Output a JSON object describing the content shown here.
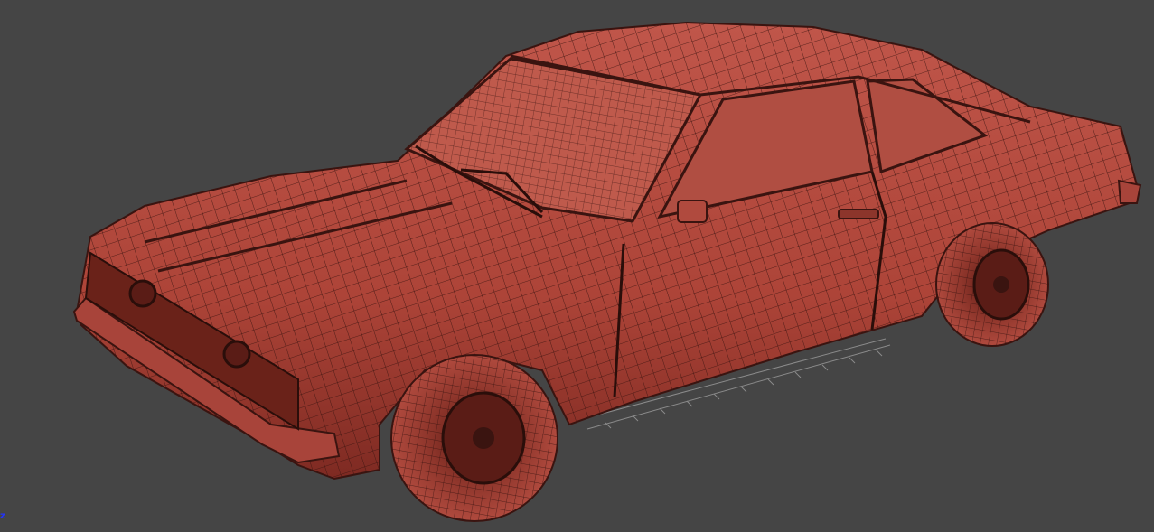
{
  "viewport": {
    "background_color": "#454545",
    "model_color": "#b44a3c",
    "wire_color": "#3a1410",
    "grid_color": "#8a8a8a"
  },
  "axis_gizmo": {
    "z_label": "z",
    "z_color": "#2233ff"
  }
}
